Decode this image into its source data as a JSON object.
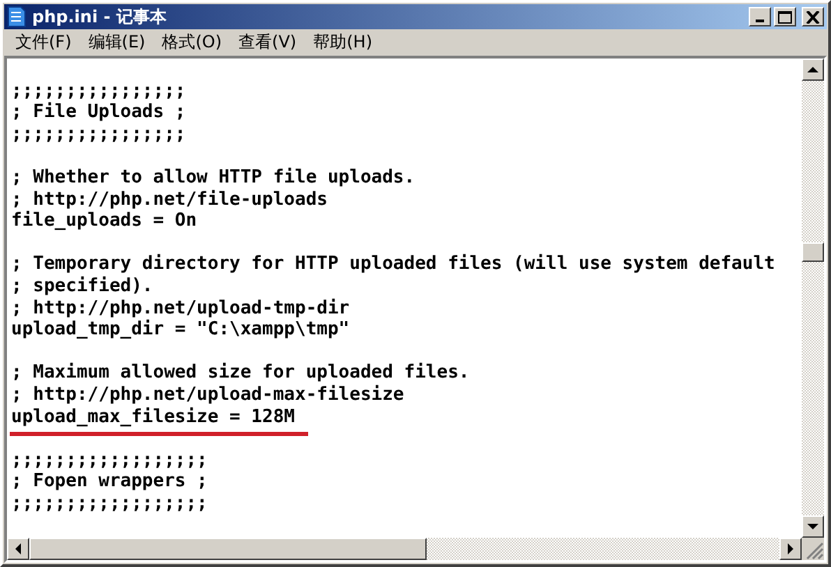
{
  "window": {
    "title": "php.ini - 记事本"
  },
  "menu": [
    "文件(F)",
    "编辑(E)",
    "格式(O)",
    "查看(V)",
    "帮助(H)"
  ],
  "lines": [
    {
      "kind": "blank"
    },
    {
      "kind": "text",
      "text": ";;;;;;;;;;;;;;;;",
      "underlined": false
    },
    {
      "kind": "text",
      "text": "; File Uploads ;",
      "underlined": false
    },
    {
      "kind": "text",
      "text": ";;;;;;;;;;;;;;;;",
      "underlined": false
    },
    {
      "kind": "blank"
    },
    {
      "kind": "text",
      "text": "; Whether to allow HTTP file uploads.",
      "underlined": false
    },
    {
      "kind": "text",
      "text": "; http://php.net/file-uploads",
      "underlined": false
    },
    {
      "kind": "text",
      "text": "file_uploads = On",
      "underlined": false
    },
    {
      "kind": "blank"
    },
    {
      "kind": "text",
      "text": "; Temporary directory for HTTP uploaded files (will use system default",
      "underlined": false
    },
    {
      "kind": "text",
      "text": "; specified).",
      "underlined": false
    },
    {
      "kind": "text",
      "text": "; http://php.net/upload-tmp-dir",
      "underlined": false
    },
    {
      "kind": "text",
      "text": "upload_tmp_dir = \"C:\\xampp\\tmp\"",
      "underlined": false
    },
    {
      "kind": "blank"
    },
    {
      "kind": "text",
      "text": "; Maximum allowed size for uploaded files.",
      "underlined": false
    },
    {
      "kind": "text",
      "text": "; http://php.net/upload-max-filesize",
      "underlined": false
    },
    {
      "kind": "text",
      "text": "upload_max_filesize = 128M",
      "underlined": true
    },
    {
      "kind": "blank"
    },
    {
      "kind": "text",
      "text": ";;;;;;;;;;;;;;;;;;",
      "underlined": false
    },
    {
      "kind": "text",
      "text": "; Fopen wrappers ;",
      "underlined": false
    },
    {
      "kind": "text",
      "text": ";;;;;;;;;;;;;;;;;;",
      "underlined": false
    }
  ]
}
